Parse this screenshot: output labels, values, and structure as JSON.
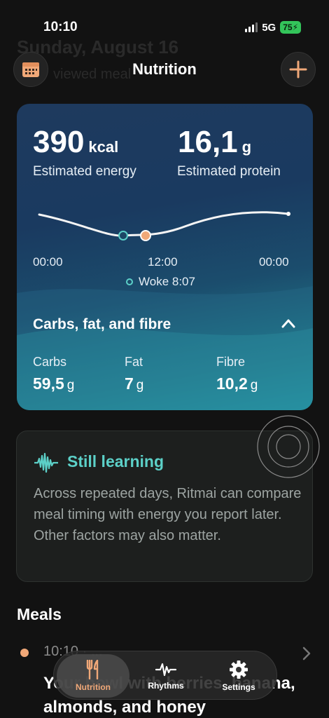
{
  "status": {
    "time": "10:10",
    "network": "5G",
    "battery": "75"
  },
  "background": {
    "date": "Sunday, August 16",
    "subtitle": "viewed meal"
  },
  "nav": {
    "title": "Nutrition"
  },
  "summary": {
    "energy_value": "390",
    "energy_unit": "kcal",
    "energy_label": "Estimated energy",
    "protein_value": "16,1",
    "protein_unit": "g",
    "protein_label": "Estimated protein"
  },
  "timeline": {
    "start": "00:00",
    "mid": "12:00",
    "end": "00:00",
    "woke": "Woke 8:07"
  },
  "macros": {
    "title": "Carbs, fat, and fibre",
    "carbs_label": "Carbs",
    "carbs_value": "59,5",
    "carbs_unit": "g",
    "fat_label": "Fat",
    "fat_value": "7",
    "fat_unit": "g",
    "fibre_label": "Fibre",
    "fibre_value": "10,2",
    "fibre_unit": "g"
  },
  "learning": {
    "title": "Still learning",
    "body": "Across repeated days, Ritmai can compare meal timing with energy you report later. Other factors may also matter."
  },
  "meals": {
    "title": "Meals",
    "items": [
      {
        "time": "10:10 · ...",
        "name": "Your bowl with berries, banana, almonds, and honey"
      }
    ]
  },
  "tabs": [
    {
      "label": "Nutrition",
      "icon": "fork-knife-icon",
      "active": true
    },
    {
      "label": "Rhythms",
      "icon": "waveform-icon",
      "active": false
    },
    {
      "label": "Settings",
      "icon": "gear-icon",
      "active": false
    }
  ],
  "colors": {
    "accent": "#f0a878",
    "teal": "#5cd0c8"
  }
}
